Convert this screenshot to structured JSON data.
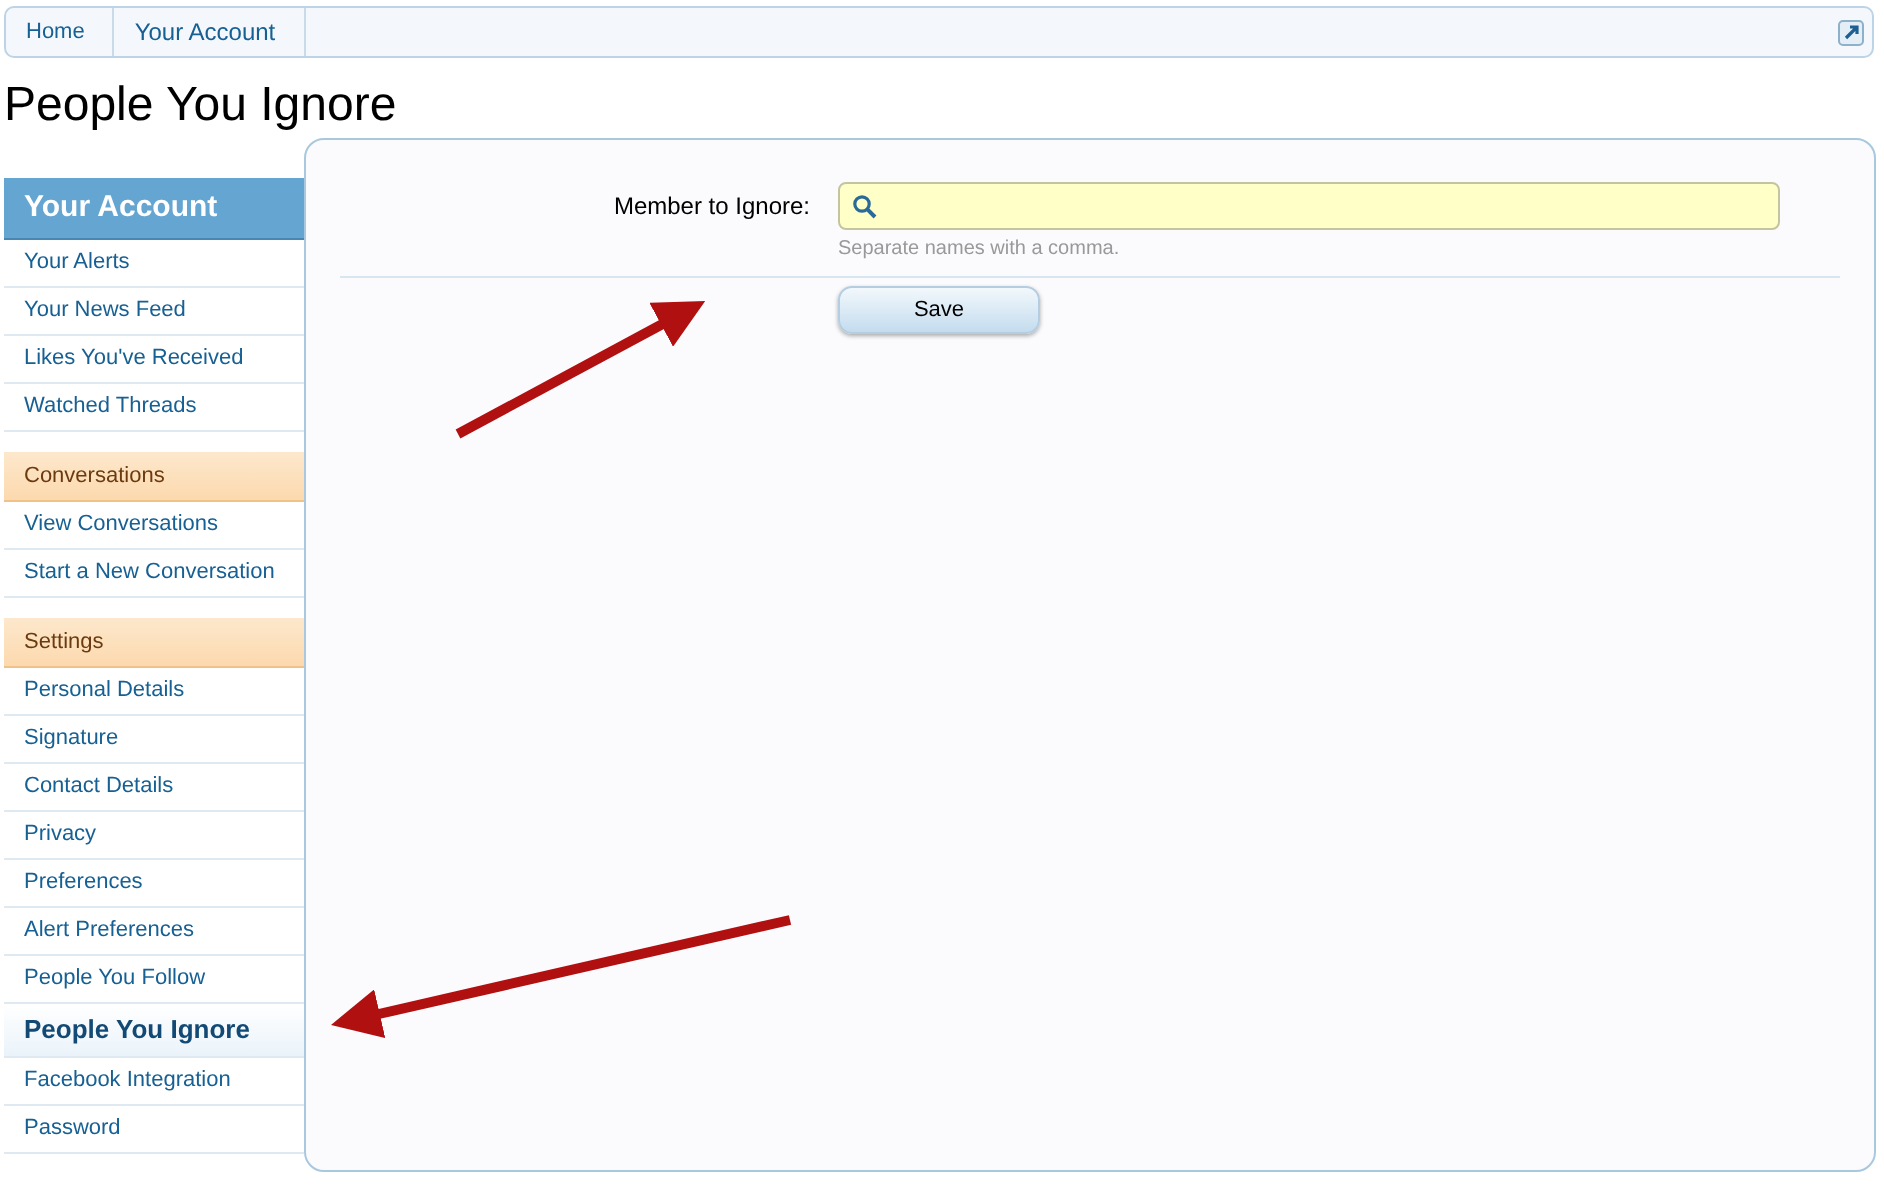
{
  "breadcrumb": [
    {
      "label": "Home"
    },
    {
      "label": "Your Account"
    }
  ],
  "page_title": "People You Ignore",
  "sidebar": {
    "title": "Your Account",
    "sections": [
      {
        "items": [
          {
            "label": "Your Alerts",
            "selected": false
          },
          {
            "label": "Your News Feed",
            "selected": false
          },
          {
            "label": "Likes You've Received",
            "selected": false
          },
          {
            "label": "Watched Threads",
            "selected": false
          }
        ]
      },
      {
        "heading": "Conversations",
        "items": [
          {
            "label": "View Conversations",
            "selected": false
          },
          {
            "label": "Start a New Conversation",
            "selected": false
          }
        ]
      },
      {
        "heading": "Settings",
        "items": [
          {
            "label": "Personal Details",
            "selected": false
          },
          {
            "label": "Signature",
            "selected": false
          },
          {
            "label": "Contact Details",
            "selected": false
          },
          {
            "label": "Privacy",
            "selected": false
          },
          {
            "label": "Preferences",
            "selected": false
          },
          {
            "label": "Alert Preferences",
            "selected": false
          },
          {
            "label": "People You Follow",
            "selected": false
          },
          {
            "label": "People You Ignore",
            "selected": true
          },
          {
            "label": "Facebook Integration",
            "selected": false
          },
          {
            "label": "Password",
            "selected": false
          }
        ]
      }
    ]
  },
  "form": {
    "label": "Member to Ignore:",
    "hint": "Separate names with a comma.",
    "button": "Save"
  }
}
